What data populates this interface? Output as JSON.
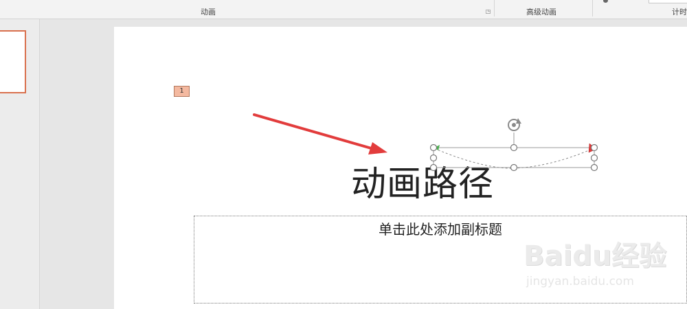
{
  "ribbon": {
    "groups": [
      {
        "label": "动画"
      },
      {
        "label": "高级动画"
      },
      {
        "label": "计时"
      }
    ]
  },
  "slide": {
    "animation_order": "1",
    "title": "动画路径",
    "subtitle_placeholder": "单击此处添加副标题"
  },
  "colors": {
    "accent": "#d9704d",
    "arrow": "#e23c3c",
    "badge": "#f4b9a0",
    "path_start": "#4caf50",
    "path_end": "#e23c3c"
  },
  "watermark": {
    "logo": "Baidu经验",
    "url": "jingyan.baidu.com"
  }
}
